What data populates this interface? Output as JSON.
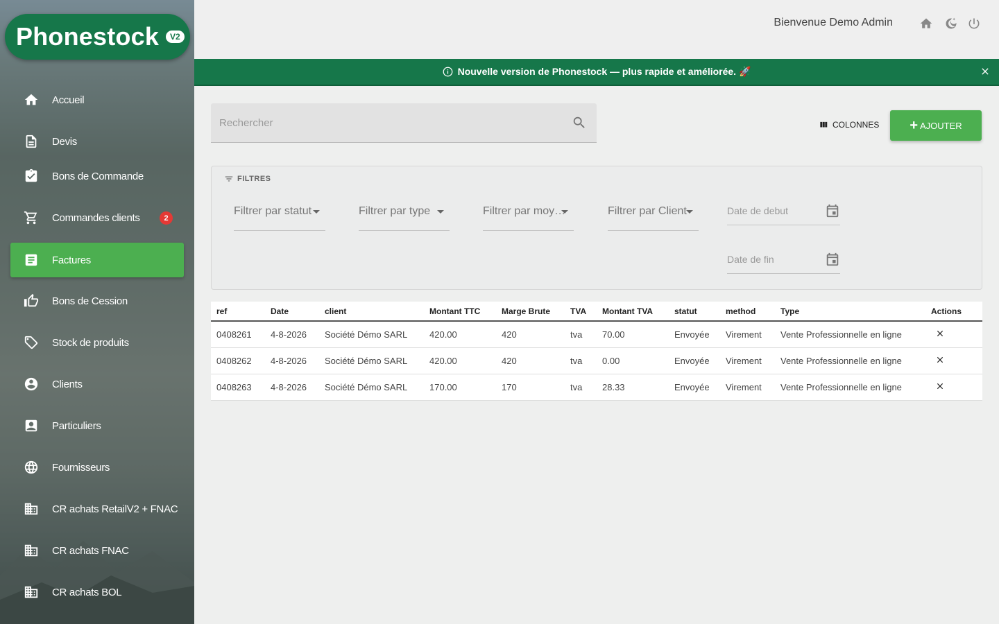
{
  "app": {
    "name": "Phonestock",
    "version": "V2"
  },
  "sidebar": {
    "items": [
      {
        "label": "Accueil",
        "icon": "home-icon"
      },
      {
        "label": "Devis",
        "icon": "document-icon"
      },
      {
        "label": "Bons de Commande",
        "icon": "clipboard-check-icon"
      },
      {
        "label": "Commandes clients",
        "icon": "cart-icon",
        "badge": "2"
      },
      {
        "label": "Factures",
        "icon": "receipt-icon",
        "active": true
      },
      {
        "label": "Bons de Cession",
        "icon": "thumb-up-icon"
      },
      {
        "label": "Stock de produits",
        "icon": "tag-icon"
      },
      {
        "label": "Clients",
        "icon": "account-circle-icon"
      },
      {
        "label": "Particuliers",
        "icon": "contact-card-icon"
      },
      {
        "label": "Fournisseurs",
        "icon": "globe-icon"
      },
      {
        "label": "CR achats RetailV2 + FNAC",
        "icon": "building-icon"
      },
      {
        "label": "CR achats FNAC",
        "icon": "building-icon"
      },
      {
        "label": "CR achats BOL",
        "icon": "building-icon"
      }
    ]
  },
  "header": {
    "welcome": "Bienvenue Demo Admin",
    "icons": [
      "home-icon",
      "dark-mode-icon",
      "power-icon"
    ]
  },
  "banner": {
    "text": "Nouvelle version de Phonestock — plus rapide et améliorée. 🚀"
  },
  "toolbar": {
    "search_placeholder": "Rechercher",
    "columns_label": "COLONNES",
    "add_label": "AJOUTER"
  },
  "filters": {
    "title": "FILTRES",
    "status": "Filtrer par statut",
    "type": "Filtrer par type",
    "method": "Filtrer par moy…",
    "client": "Filtrer par Client",
    "date_start": "Date de debut",
    "date_end": "Date de fin"
  },
  "table": {
    "columns": [
      "ref",
      "Date",
      "client",
      "Montant TTC",
      "Marge Brute",
      "TVA",
      "Montant TVA",
      "statut",
      "method",
      "Type",
      "Actions"
    ],
    "rows": [
      [
        "0408261",
        "4-8-2026",
        "Société Démo SARL",
        "420.00",
        "420",
        "tva",
        "70.00",
        "Envoyée",
        "Virement",
        "Vente Professionnelle en ligne"
      ],
      [
        "0408262",
        "4-8-2026",
        "Société Démo SARL",
        "420.00",
        "420",
        "tva",
        "0.00",
        "Envoyée",
        "Virement",
        "Vente Professionnelle en ligne"
      ],
      [
        "0408263",
        "4-8-2026",
        "Société Démo SARL",
        "170.00",
        "170",
        "tva",
        "28.33",
        "Envoyée",
        "Virement",
        "Vente Professionnelle en ligne"
      ]
    ]
  },
  "colors": {
    "brand": "#16774a",
    "accent": "#4caf50",
    "badge": "#e53935"
  }
}
